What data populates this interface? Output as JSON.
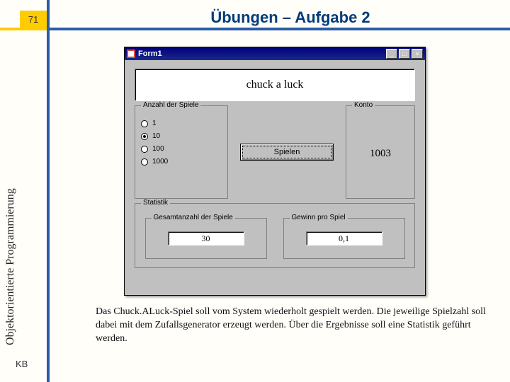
{
  "page_number": "71",
  "title": "Übungen – Aufgabe 2",
  "sidebar_label": "Objektorientierte Programmierung",
  "footer_initials": "KB",
  "body_text": "Das Chuck.ALuck-Spiel soll vom System wiederholt gespielt werden. Die jeweilige Spielzahl soll dabei mit dem Zufallsgenerator erzeugt werden. Über die Ergebnisse soll eine Statistik geführt werden.",
  "form": {
    "window_title": "Form1",
    "panel_title": "chuck a luck",
    "groups": {
      "plays": {
        "title": "Anzahl der Spiele",
        "options": [
          "1",
          "10",
          "100",
          "1000"
        ],
        "selected_index": 1
      },
      "konto": {
        "title": "Konto",
        "value": "1003"
      },
      "stat": {
        "title": "Statistik"
      },
      "total": {
        "title": "Gesamtanzahl der Spiele",
        "value": "30"
      },
      "avg": {
        "title": "Gewinn pro Spiel",
        "value": "0,1"
      }
    },
    "play_button": "Spielen",
    "win_buttons": {
      "min": "_",
      "max": "□",
      "close": "×"
    }
  }
}
